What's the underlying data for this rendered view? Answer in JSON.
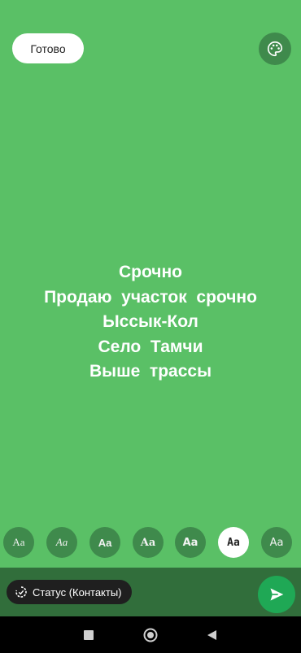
{
  "header": {
    "done_label": "Готово",
    "palette_icon": "palette-icon"
  },
  "status": {
    "lines": [
      "Срочно",
      "Продаю  участок  срочно",
      "Ыссык-Кол",
      "Село  Тамчи",
      "Выше  трассы"
    ]
  },
  "font_options": [
    {
      "label": "Aa",
      "style": "serif",
      "selected": false
    },
    {
      "label": "Aa",
      "style": "italic-serif",
      "selected": false
    },
    {
      "label": "Aa",
      "style": "sans-bold",
      "selected": false
    },
    {
      "label": "Aa",
      "style": "serif-bold",
      "selected": false
    },
    {
      "label": "Aa",
      "style": "sans-heavy",
      "selected": false
    },
    {
      "label": "Aa",
      "style": "mono-bold",
      "selected": true
    },
    {
      "label": "Aa",
      "style": "sans",
      "selected": false
    }
  ],
  "footer": {
    "audience_label": "Статус (Контакты)",
    "audience_icon": "status-ring-icon",
    "send_icon": "send-icon"
  },
  "colors": {
    "background": "#5ac066",
    "accent": "#1fa855",
    "bar": "#316e3b"
  },
  "nav": {
    "recent_icon": "square-icon",
    "home_icon": "circle-icon",
    "back_icon": "triangle-back-icon"
  }
}
